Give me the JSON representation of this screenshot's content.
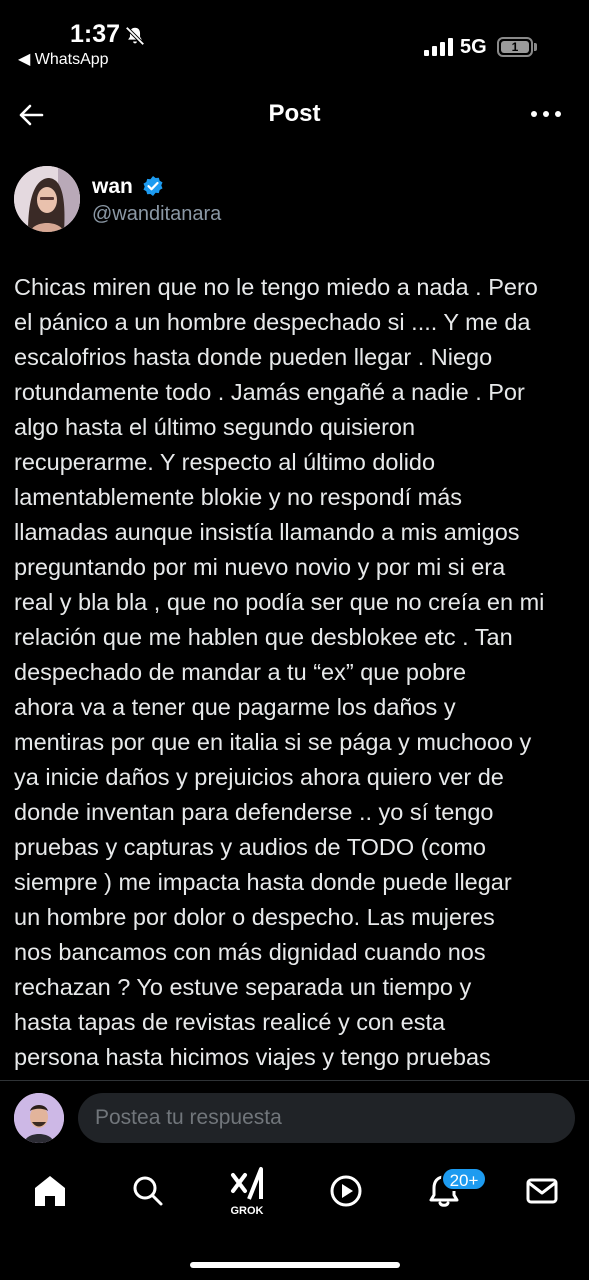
{
  "status_bar": {
    "time": "1:37",
    "back_app": "◀ WhatsApp",
    "network": "5G",
    "battery": "1"
  },
  "header": {
    "title": "Post",
    "back_icon": "arrow-left-icon",
    "more_icon": "more-horizontal-icon"
  },
  "author": {
    "name": "wan",
    "handle": "@wanditanara",
    "verified_color": "#1d9bf0"
  },
  "post": {
    "text": "Chicas miren que no le tengo miedo a nada . Pero\nel pánico a un hombre despechado si .... Y me da\nescalofrios hasta donde pueden llegar .  Niego\nrotundamente todo . Jamás engañé a nadie . Por\nalgo hasta el último segundo quisieron\nrecuperarme. Y respecto al último dolido\nlamentablemente blokie  y no respondí más\nllamadas aunque insistía llamando a mis amigos\npreguntando por mi nuevo novio y por mi si era\nreal y bla bla , que no podía ser que no creía en mi\nrelación que me hablen que desblokee etc . Tan\ndespechado de mandar a tu “ex” que pobre\nahora va a tener que pagarme los daños y\nmentiras por que en italia si se pága  y muchooo y\nya inicie  daños y prejuicios ahora quiero ver de\ndonde inventan para defenderse .. yo sí tengo\npruebas y capturas y audios de TODO (como\nsiempre )  me impacta hasta donde puede llegar\nun hombre por dolor o despecho. Las mujeres\nnos bancamos con más dignidad cuando nos\nrechazan ?  Yo estuve separada un tiempo y\nhasta tapas de revistas realicé y con esta\npersona hasta hicimos viajes y tengo pruebas"
  },
  "reply": {
    "placeholder": "Postea tu respuesta"
  },
  "bottom_nav": {
    "items": [
      "home-icon",
      "search-icon",
      "grok-icon",
      "video-icon",
      "notifications-icon",
      "messages-icon"
    ],
    "grok_label": "GROK",
    "notification_badge": "20+",
    "badge_color": "#1d9bf0"
  },
  "colors": {
    "background": "#000000",
    "text": "#e7e9ea",
    "secondary_text": "#8b98a5",
    "accent": "#1d9bf0"
  }
}
